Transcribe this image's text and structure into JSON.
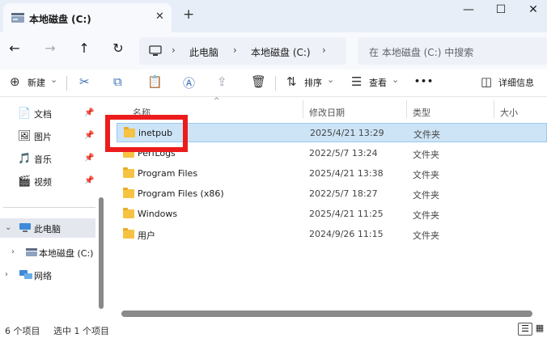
{
  "window": {
    "tab_title": "本地磁盘 (C:)",
    "tab_close": "✕",
    "new_tab": "+",
    "minimize": "—",
    "maximize": "☐",
    "close": "✕"
  },
  "nav": {
    "back": "←",
    "forward": "→",
    "up": "↑",
    "refresh": "↻"
  },
  "address": {
    "chev": "›",
    "crumbs": [
      "此电脑",
      "本地磁盘 (C:)"
    ],
    "search_placeholder": "在 本地磁盘 (C:) 中搜索"
  },
  "toolbar": {
    "new_label": "新建",
    "sort_label": "排序",
    "view_label": "查看",
    "more": "•••",
    "details_label": "详细信息",
    "caret": "⌄"
  },
  "sidebar": {
    "quick": [
      {
        "label": "文档",
        "icon": "📄"
      },
      {
        "label": "图片",
        "icon": "🖼"
      },
      {
        "label": "音乐",
        "icon": "🎵"
      },
      {
        "label": "视频",
        "icon": "🎬"
      }
    ],
    "pin": "📌",
    "this_pc": "此电脑",
    "local_disk": "本地磁盘 (C:)",
    "network": "网络"
  },
  "columns": {
    "name": "名称",
    "date": "修改日期",
    "type": "类型",
    "size": "大小"
  },
  "files": [
    {
      "name": "inetpub",
      "date": "2025/4/21 13:29",
      "type": "文件夹"
    },
    {
      "name": "PerfLogs",
      "date": "2022/5/7 13:24",
      "type": "文件夹"
    },
    {
      "name": "Program Files",
      "date": "2025/4/21 13:38",
      "type": "文件夹"
    },
    {
      "name": "Program Files (x86)",
      "date": "2022/5/7 18:27",
      "type": "文件夹"
    },
    {
      "name": "Windows",
      "date": "2025/4/21 11:25",
      "type": "文件夹"
    },
    {
      "name": "用户",
      "date": "2024/9/26 11:15",
      "type": "文件夹"
    }
  ],
  "status": {
    "count": "6 个项目",
    "selected": "选中 1 个项目"
  },
  "colors": {
    "accent": "#3a6fb5",
    "highlight": "#ec1c1c",
    "selection": "#cde4f7"
  }
}
